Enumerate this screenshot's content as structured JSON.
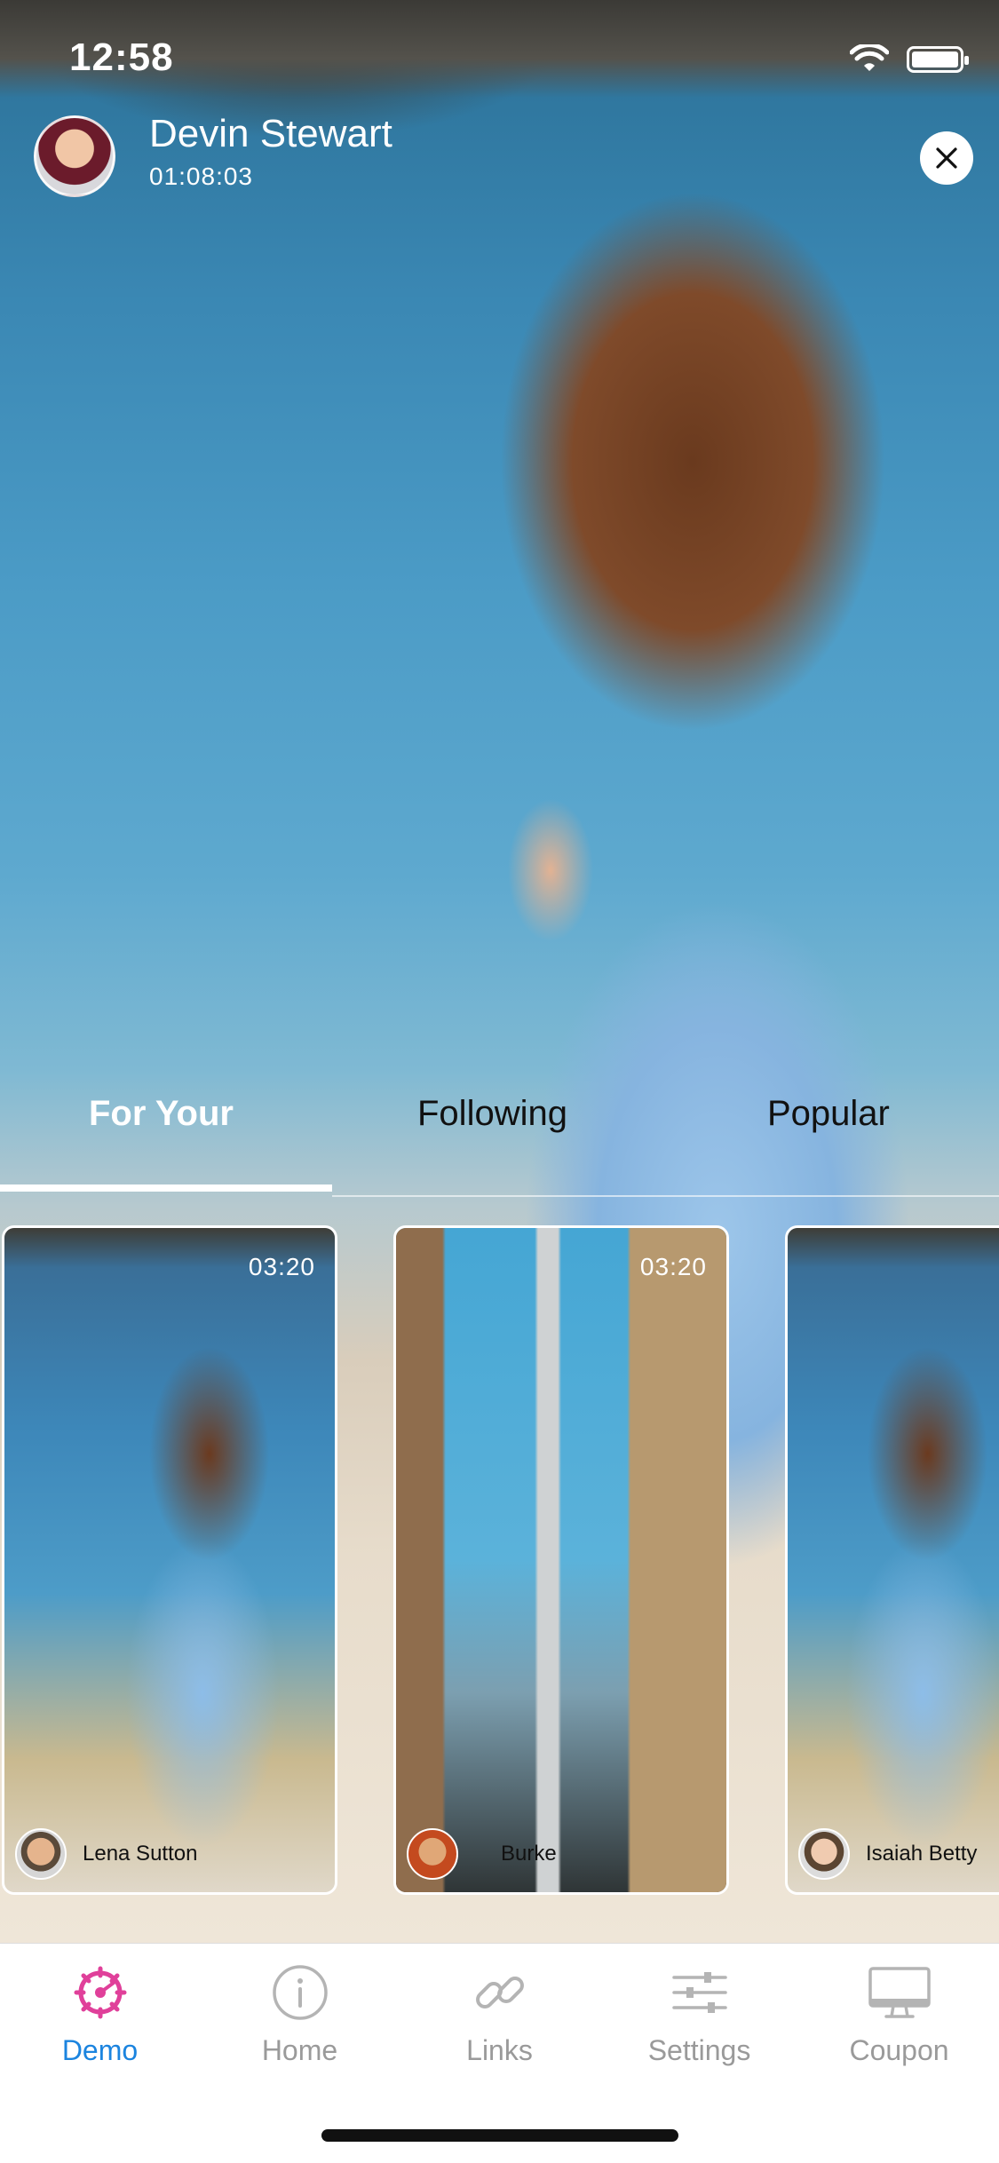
{
  "status_bar": {
    "time": "12:58"
  },
  "header": {
    "user_name": "Devin Stewart",
    "elapsed": "01:08:03"
  },
  "tabs": [
    {
      "label": "For Your",
      "active": true
    },
    {
      "label": "Following",
      "active": false
    },
    {
      "label": "Popular",
      "active": false
    }
  ],
  "cards": [
    {
      "duration": "03:20",
      "author": "Lena Sutton"
    },
    {
      "duration": "03:20",
      "author": "Burke"
    },
    {
      "duration": "",
      "author": "Isaiah Betty"
    }
  ],
  "bottom_nav": [
    {
      "label": "Demo",
      "icon": "gear-icon",
      "active": true
    },
    {
      "label": "Home",
      "icon": "info-icon",
      "active": false
    },
    {
      "label": "Links",
      "icon": "link-icon",
      "active": false
    },
    {
      "label": "Settings",
      "icon": "sliders-icon",
      "active": false
    },
    {
      "label": "Coupon",
      "icon": "monitor-icon",
      "active": false
    }
  ],
  "colors": {
    "accent": "#1b84df",
    "demo_icon": "#e0409a",
    "inactive": "#9a9a9a"
  }
}
